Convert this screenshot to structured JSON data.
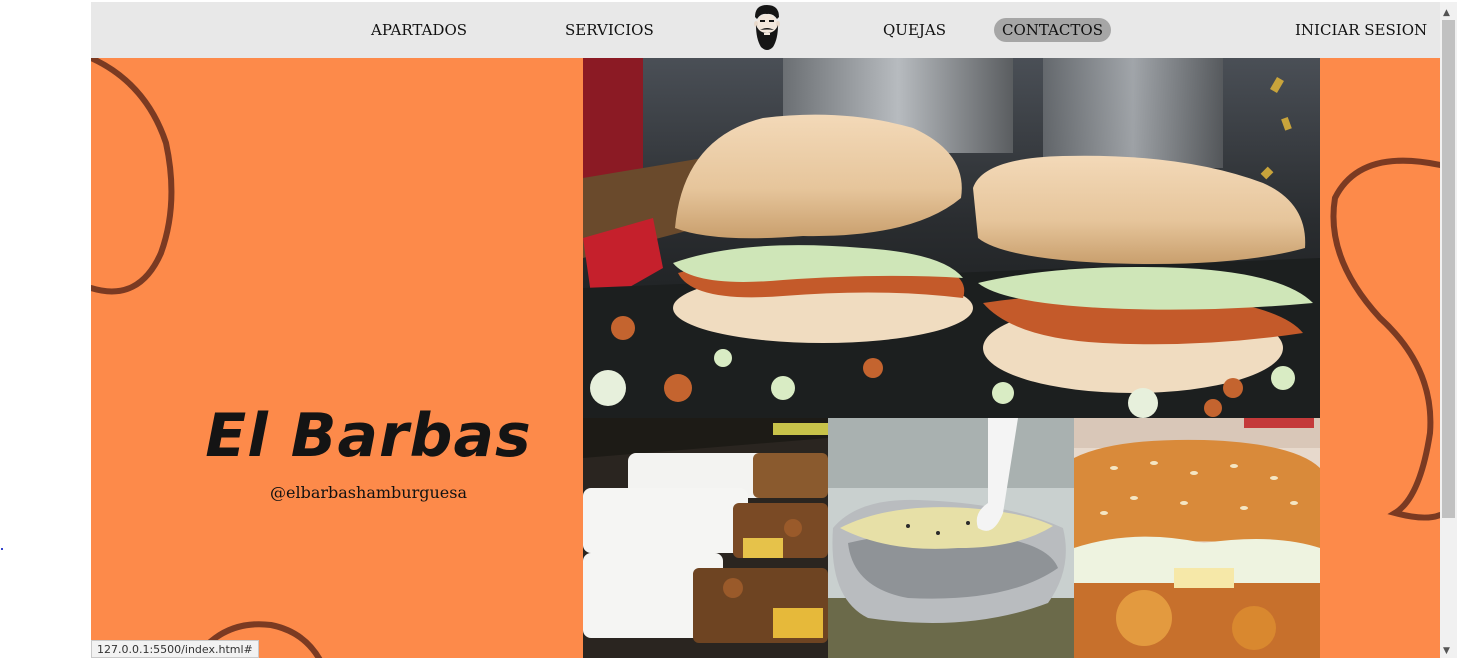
{
  "nav": {
    "apartados": "APARTADOS",
    "servicios": "SERVICIOS",
    "quejas": "QUEJAS",
    "contactos": "CONTACTOS",
    "login": "INICIAR SESION",
    "active_item": "CONTACTOS"
  },
  "hero": {
    "title": "El Barbas",
    "handle": "@elbarbashamburguesa"
  },
  "photos": {
    "main": "tortas-on-griddle-photo",
    "thumb1": "takeout-containers-photo",
    "thumb2": "baked-potato-foil-photo",
    "thumb3": "sesame-burger-photo"
  },
  "status_bar": {
    "url": "127.0.0.1:5500/index.html#"
  },
  "colors": {
    "hero_bg": "#fd8a4a",
    "swirl": "#7b3a22",
    "navbar_bg": "#e8e8e8",
    "active_pill": "#a6a6a6"
  }
}
